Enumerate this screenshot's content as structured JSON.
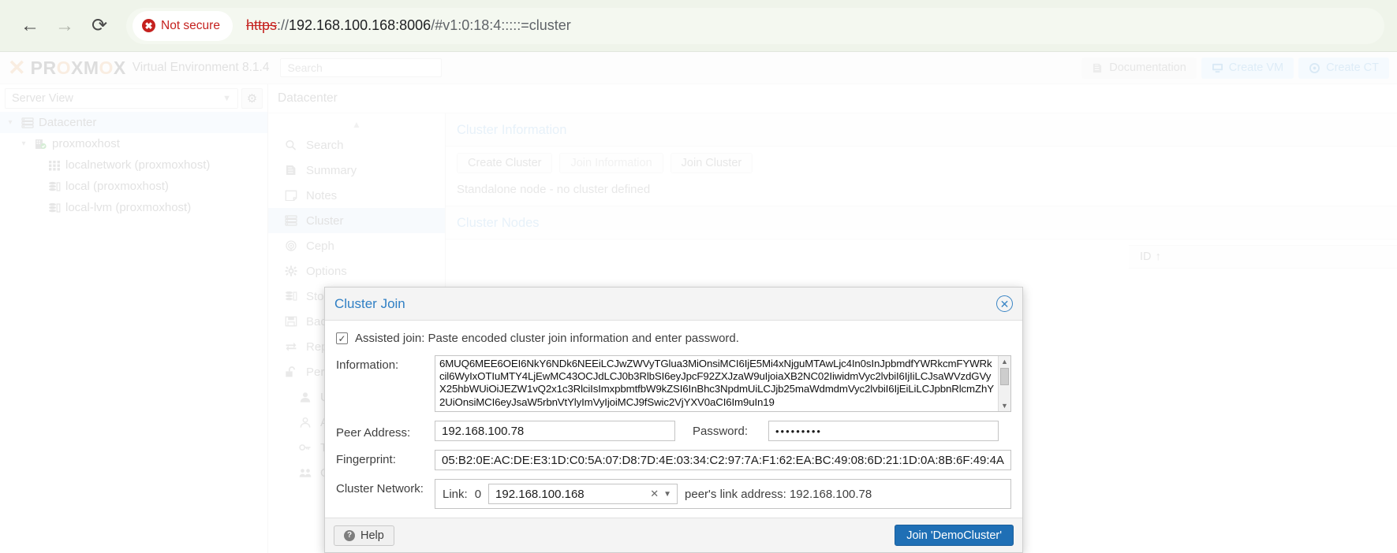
{
  "browser": {
    "back_icon": "arrow-left-icon",
    "forward_icon": "arrow-right-icon",
    "reload_icon": "reload-icon",
    "security_label": "Not secure",
    "security_icon": "warning-circle-icon",
    "url_scheme": "https",
    "url_sep": "://",
    "url_host": "192.168.100.168:8006",
    "url_rest": "/#v1:0:18:4:::::=cluster",
    "url_full": "https://192.168.100.168:8006/#v1:0:18:4:::::=cluster",
    "colors": {
      "danger": "#c5221f",
      "bar_bg": "#eff4ea"
    }
  },
  "header": {
    "logo_x": "X",
    "logo_pro": "PRO",
    "logo_o": "X",
    "logo_mo": "MO",
    "logo_x2": "X",
    "logo_full": "PROXMOX",
    "version": "Virtual Environment 8.1.4",
    "search_placeholder": "Search",
    "documentation_label": "Documentation",
    "documentation_icon": "book-icon",
    "create_vm_label": "Create VM",
    "create_vm_icon": "monitor-icon",
    "create_ct_label": "Create CT",
    "create_ct_icon": "container-icon",
    "accent": "#7ab4e0"
  },
  "sidebar": {
    "view_selector": "Server View",
    "view_caret_icon": "chevron-down-icon",
    "gear_icon": "gear-icon",
    "tree": [
      {
        "label": "Datacenter",
        "icon": "datacenter-icon",
        "selected": true,
        "depth": 0,
        "expander": "chevron-down-icon"
      },
      {
        "label": "proxmoxhost",
        "icon": "node-online-icon",
        "selected": false,
        "depth": 1,
        "expander": "chevron-down-icon"
      },
      {
        "label": "localnetwork (proxmoxhost)",
        "icon": "network-icon",
        "selected": false,
        "depth": 2,
        "expander": ""
      },
      {
        "label": "local (proxmoxhost)",
        "icon": "storage-icon",
        "selected": false,
        "depth": 2,
        "expander": ""
      },
      {
        "label": "local-lvm (proxmoxhost)",
        "icon": "storage-icon",
        "selected": false,
        "depth": 2,
        "expander": ""
      }
    ]
  },
  "breadcrumb": "Datacenter",
  "nav": {
    "collapse_icon": "chevron-up-icon",
    "items": [
      {
        "label": "Search",
        "icon": "search-icon",
        "active": false,
        "sub": false
      },
      {
        "label": "Summary",
        "icon": "book-icon",
        "active": false,
        "sub": false
      },
      {
        "label": "Notes",
        "icon": "note-icon",
        "active": false,
        "sub": false
      },
      {
        "label": "Cluster",
        "icon": "cluster-icon",
        "active": true,
        "sub": false
      },
      {
        "label": "Ceph",
        "icon": "ceph-icon",
        "active": false,
        "sub": false
      },
      {
        "label": "Options",
        "icon": "gear-icon",
        "active": false,
        "sub": false
      },
      {
        "label": "Storage",
        "icon": "storage-icon",
        "active": false,
        "sub": false
      },
      {
        "label": "Backup",
        "icon": "save-icon",
        "active": false,
        "sub": false
      },
      {
        "label": "Replication",
        "icon": "replication-icon",
        "active": false,
        "sub": false
      },
      {
        "label": "Permissions",
        "icon": "unlock-icon",
        "active": false,
        "sub": false
      },
      {
        "label": "Users",
        "icon": "user-icon",
        "active": false,
        "sub": true
      },
      {
        "label": "API Tokens",
        "icon": "user-outline-icon",
        "active": false,
        "sub": true
      },
      {
        "label": "Two Factor",
        "icon": "key-icon",
        "active": false,
        "sub": true
      },
      {
        "label": "Groups",
        "icon": "group-icon",
        "active": false,
        "sub": true
      }
    ]
  },
  "main": {
    "cluster_information_title": "Cluster Information",
    "buttons": [
      {
        "label": "Create Cluster",
        "disabled": false
      },
      {
        "label": "Join Information",
        "disabled": true
      },
      {
        "label": "Join Cluster",
        "disabled": false
      }
    ],
    "standalone_note": "Standalone node - no cluster defined",
    "cluster_nodes_title": "Cluster Nodes",
    "grid_col_id": "ID",
    "grid_sort_icon": "sort-asc-icon"
  },
  "modal": {
    "title": "Cluster Join",
    "close_icon": "close-circle-icon",
    "assisted_checked": true,
    "assisted_check_glyph": "checkmark-icon",
    "assisted_label": "Assisted join: Paste encoded cluster join information and enter password.",
    "information_label": "Information:",
    "information_value": "6MUQ6MEE6OEI6NkY6NDk6NEEiLCJwZWVyTGlua3MiOnsiMCI6IjE5Mi4xNjguMTAwLjc4In0sInJpbmdfYWRkciI6WyIxOTIuMTY4LjEwMC43OCJdLCJ0b3RlbSI6eyJpcF92ZXJzaW9uIjoiaXB2NCIsImxpbmtfMCI6eyJiaW5kbmV0YWRkciI6IjE5Mi4xNjguMTAwLjc4IiwibGlua251bWJlciI6IjAifSwic2VjYXV0aCI6Im9uIiwidmVyc2lvbiI6IjIifX0=",
    "information_lines": [
      "6MUQ6MEE6OEI6NkY6NDk6NEEiLCJwZWVyTGlua3MiOnsiMCI6IjE5Mi4xNjguMTAwLjc4In0sInJpbmdfYWRkcmFYWRkc",
      "il6WyIxOTIuMTY4LjEwMC43OCJdLCJ0b3RlbSI6eyJpcF92ZXJzaW9uIjoiaXB2NC02IiwidmVyc2lvbiI6IjIiLCJsaW",
      "VzdGVyX25hbWUiOiJEZW1vQ2x1c3RlciIsImxpbmtfbW9kZSI6InBhc3NpdmUiLCJjb25maWdmdmVyc2lvbiI6IjEiLiL",
      "CJpbnRlcmZhY2UiOnsiMCI6eyJsaW5rbnVtYlyImVyIjoiMCJ9fSwic2VjYXV0aCI6Im9uIn19"
    ],
    "scrollbar": {
      "up_icon": "caret-up-icon",
      "down_icon": "caret-down-icon"
    },
    "peer_address_label": "Peer Address:",
    "peer_address_value": "192.168.100.78",
    "password_label": "Password:",
    "password_value": "•••••••••",
    "fingerprint_label": "Fingerprint:",
    "fingerprint_value": "05:B2:0E:AC:DE:E3:1D:C0:5A:07:D8:7D:4E:03:34:C2:97:7A:F1:62:EA:BC:49:08:6D:21:1D:0A:8B:6F:49:4A",
    "cluster_network_label": "Cluster Network:",
    "link_label": "Link:",
    "link_number": "0",
    "link_value": "192.168.100.168",
    "link_clear_icon": "clear-x-icon",
    "link_caret_icon": "chevron-down-icon",
    "peer_link_note": "peer's link address: 192.168.100.78",
    "help_label": "Help",
    "help_icon": "question-circle-icon",
    "join_label": "Join 'DemoCluster'",
    "accent": "#1f6fb5"
  }
}
